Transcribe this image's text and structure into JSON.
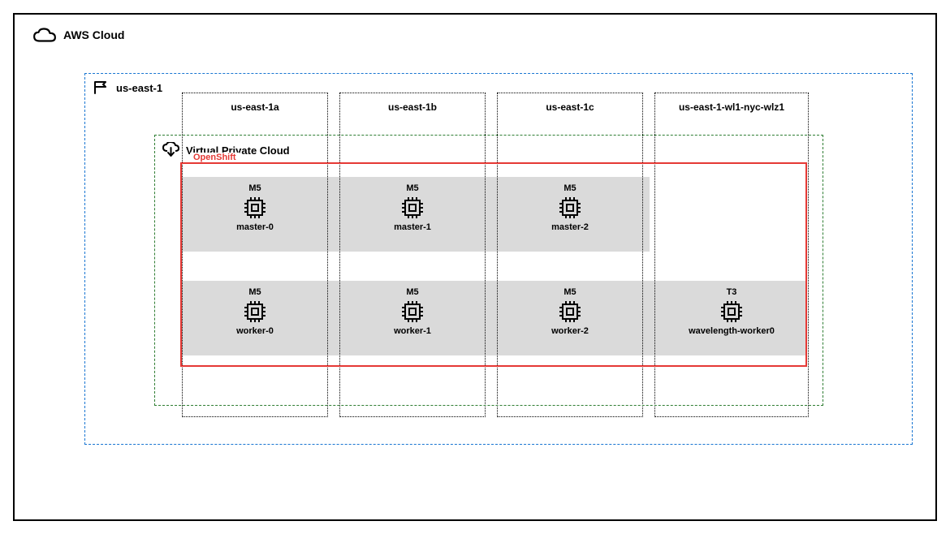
{
  "cloud": {
    "label": "AWS Cloud"
  },
  "region": {
    "label": "us-east-1"
  },
  "vpc": {
    "label": "Virtual Private Cloud"
  },
  "openshift": {
    "label": "OpenShift"
  },
  "az": [
    {
      "name": "us-east-1a"
    },
    {
      "name": "us-east-1b"
    },
    {
      "name": "us-east-1c"
    },
    {
      "name": "us-east-1-wl1-nyc-wlz1"
    }
  ],
  "nodes": {
    "masters": [
      {
        "instance_type": "M5",
        "name": "master-0"
      },
      {
        "instance_type": "M5",
        "name": "master-1"
      },
      {
        "instance_type": "M5",
        "name": "master-2"
      }
    ],
    "workers": [
      {
        "instance_type": "M5",
        "name": "worker-0"
      },
      {
        "instance_type": "M5",
        "name": "worker-1"
      },
      {
        "instance_type": "M5",
        "name": "worker-2"
      },
      {
        "instance_type": "T3",
        "name": "wavelength-worker0"
      }
    ]
  },
  "colors": {
    "region_border": "#1976D2",
    "vpc_border": "#2E7D32",
    "openshift_border": "#E53935",
    "band_bg": "#DADADA"
  }
}
